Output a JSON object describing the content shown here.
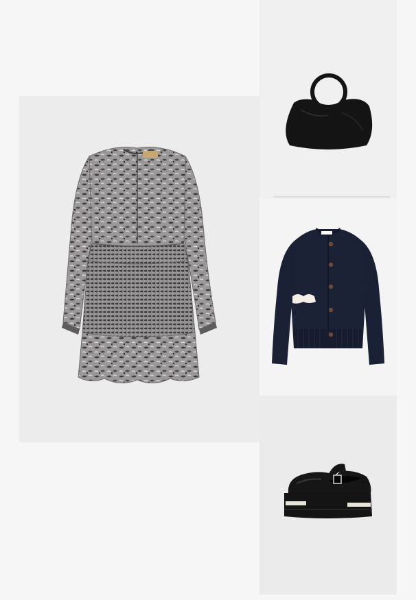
{
  "outfit": {
    "items": [
      {
        "item": "dress",
        "image": "snakeskin-print-smocked-mini-dress"
      },
      {
        "item": "bag",
        "image": "black-leather-ring-handle-handbag"
      },
      {
        "item": "cardigan",
        "image": "navy-knit-cardigan-with-white-ruffle-pocket"
      },
      {
        "item": "shoes",
        "image": "black-platform-mary-jane-shoes"
      }
    ]
  },
  "colors": {
    "page_background": "#f6f6f6",
    "dress_tile_background": "#ececec",
    "bag_tile_background": "#f0f0f0",
    "cardigan_tile_background": "#f4f4f4",
    "shoes_tile_background": "#ebebeb",
    "dress_base": "#8f8d8e",
    "bag_leather": "#141414",
    "cardigan_navy": "#1b2236",
    "shoe_leather": "#141414"
  }
}
